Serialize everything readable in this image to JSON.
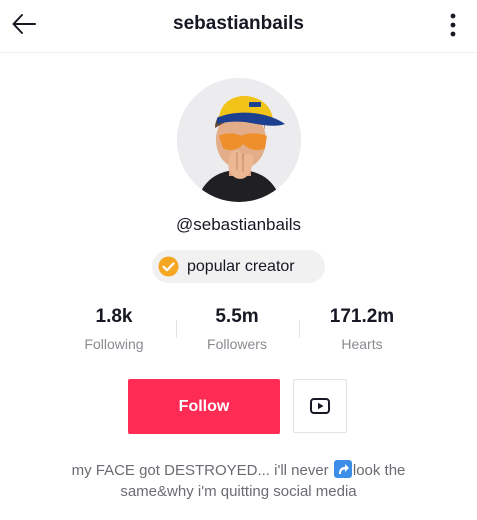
{
  "header": {
    "title": "sebastianbails",
    "back_icon": "arrow-left-icon",
    "more_icon": "vertical-dots-icon"
  },
  "profile": {
    "avatar_alt": "profile photo",
    "handle": "@sebastianbails",
    "badge": {
      "icon": "verified-check-icon",
      "label": "popular creator",
      "icon_color": "#f5a623"
    }
  },
  "stats": [
    {
      "value": "1.8k",
      "label": "Following"
    },
    {
      "value": "5.5m",
      "label": "Followers"
    },
    {
      "value": "171.2m",
      "label": "Hearts"
    }
  ],
  "actions": {
    "follow_label": "Follow",
    "follow_color": "#fe2c55",
    "youtube_icon": "youtube-icon"
  },
  "bio": {
    "line1_before": "my FACE got DESTROYED... i'll never",
    "emoji": "curved-arrow-emoji",
    "line1_after": "look the",
    "line2": "same&why i'm quitting social media"
  }
}
